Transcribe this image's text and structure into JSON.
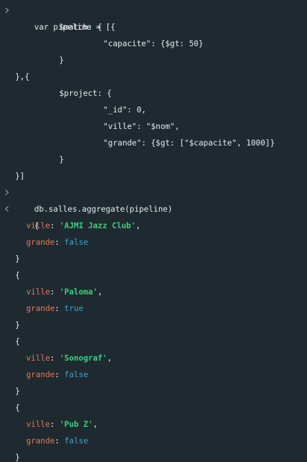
{
  "input": {
    "lines": [
      "var pipeline = [{",
      "$match: {",
      "\"capacite\": {$gt: 50}",
      "}",
      "},{",
      "$project: {",
      "\"_id\": 0,",
      "\"ville\": \"$nom\",",
      "\"grande\": {$gt: [\"$capacite\", 1000]}",
      "}",
      "}]"
    ],
    "command": "db.salles.aggregate(pipeline)"
  },
  "output": {
    "open_brace": "{",
    "close_brace": "}",
    "key_ville": "ville",
    "key_grande": "grande",
    "colon": ":",
    "comma": ",",
    "records": [
      {
        "ville": "'AJMI Jazz Club'",
        "grande": "false"
      },
      {
        "ville": "'Paloma'",
        "grande": "true"
      },
      {
        "ville": "'Sonograf'",
        "grande": "false"
      },
      {
        "ville": "'Pub Z'",
        "grande": "false"
      }
    ]
  },
  "colors": {
    "background": "#1f2a30",
    "key": "#e27a59",
    "string": "#38d17c",
    "boolean": "#3ea2d9",
    "prompt": "#8a979f"
  },
  "icons": {
    "input_prompt": "chevron-right-icon",
    "output_prompt": "chevron-left-icon"
  }
}
